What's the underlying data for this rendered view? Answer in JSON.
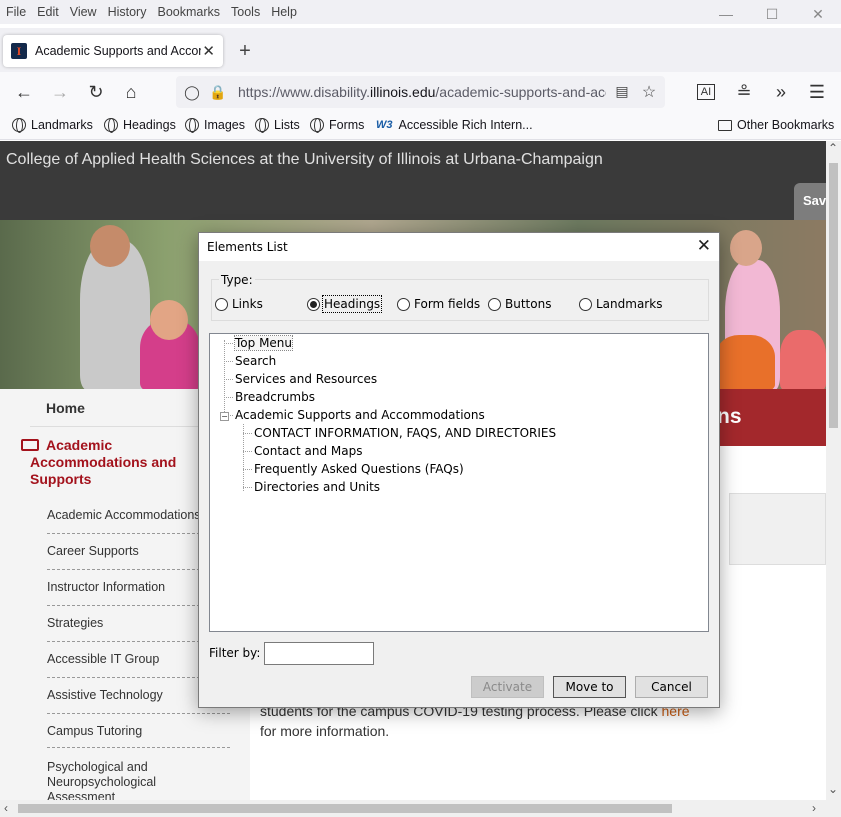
{
  "browser": {
    "menu": [
      "File",
      "Edit",
      "View",
      "History",
      "Bookmarks",
      "Tools",
      "Help"
    ],
    "tab_title": "Academic Supports and Accommodations",
    "favicon_letter": "I",
    "url_prefix": "https://www.disability.",
    "url_domain": "illinois.edu",
    "url_suffix": "/academic-supports-and-accommodations",
    "bookmarks": [
      "Landmarks",
      "Headings",
      "Images",
      "Lists",
      "Forms",
      "Accessible Rich Intern..."
    ],
    "w3_badge": "W3",
    "other_bookmarks": "Other Bookmarks"
  },
  "page": {
    "college": "College of Applied Health Sciences at the University of Illinois at Urbana-Champaign",
    "save_tab": "Sav",
    "home": "Home",
    "section_title": "Academic Accommodations and Supports",
    "subnav": [
      "Academic Accommodations",
      "Career Supports",
      "Instructor Information",
      "Strategies",
      "Accessible IT Group",
      "Assistive Technology",
      "Campus Tutoring",
      "Psychological and Neuropsychological Assessment"
    ],
    "banner_heading_fragment": "ns",
    "body_text_1": "students for the campus COVID-19 testing process.  Please click ",
    "body_link": "here",
    "body_text_2": "for more information."
  },
  "dialog": {
    "title": "Elements List",
    "type_label": "Type:",
    "types": [
      "Links",
      "Headings",
      "Form fields",
      "Buttons",
      "Landmarks"
    ],
    "selected_type": "Headings",
    "tree": [
      "Top Menu",
      "Search",
      "Services and Resources",
      "Breadcrumbs",
      "Academic Supports and Accommodations",
      "CONTACT INFORMATION, FAQS, AND DIRECTORIES",
      "Contact and Maps",
      "Frequently Asked Questions (FAQs)",
      "Directories and Units"
    ],
    "expander": "−",
    "filter_label": "Filter by:",
    "filter_value": "",
    "buttons": {
      "activate": "Activate",
      "move_to": "Move to",
      "cancel": "Cancel"
    }
  },
  "colors": {
    "brand_red": "#a3121c",
    "link_orange": "#c75b12",
    "header_dark": "#3a3a3a"
  }
}
